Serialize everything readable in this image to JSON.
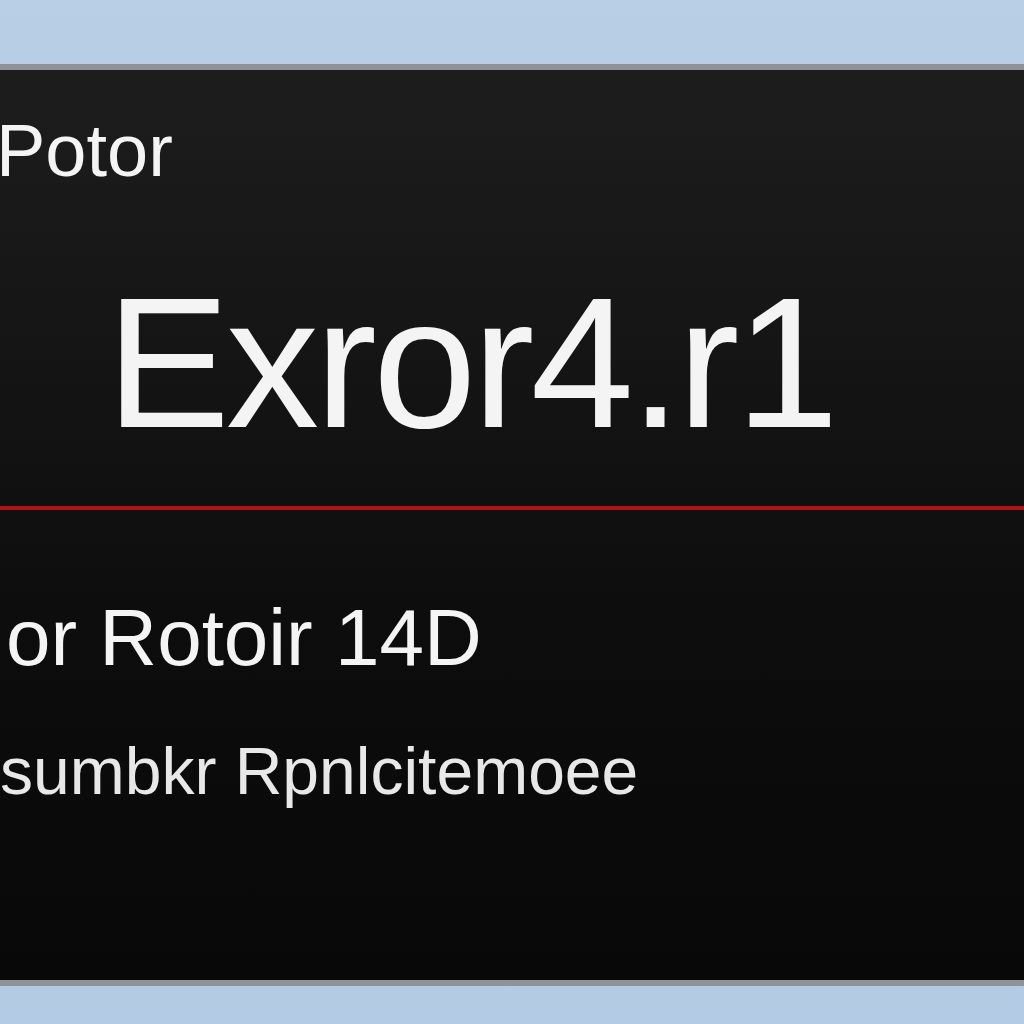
{
  "screen": {
    "title": "Potor",
    "headline": "Exror4.r1",
    "code_line": "or Rotoir 14D",
    "detail_line": "sumbkr Rpnlcitemoee"
  }
}
